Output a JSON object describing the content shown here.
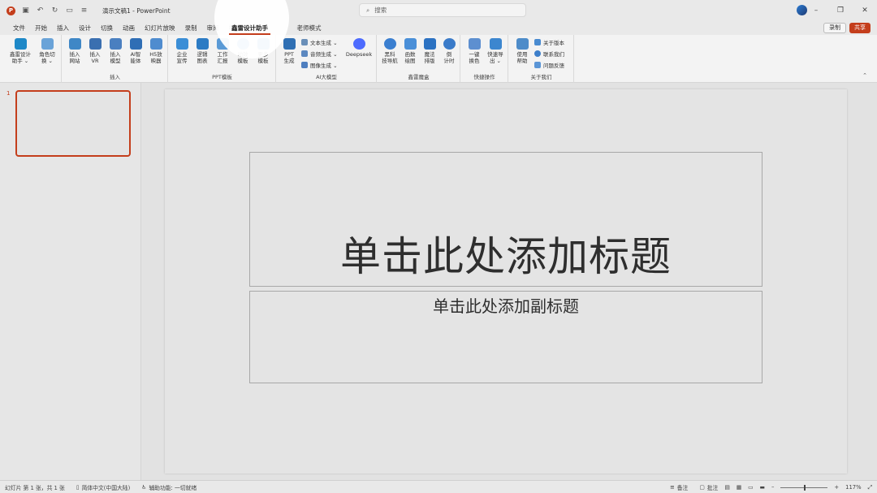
{
  "app": {
    "doc_title": "演示文稿1",
    "app_name": "PowerPoint",
    "title_sep": " - "
  },
  "search": {
    "placeholder": "搜索"
  },
  "title_icons": [
    "powerpoint-logo",
    "save-icon",
    "undo-icon",
    "redo-icon",
    "customize-icon"
  ],
  "tabs": [
    "文件",
    "开始",
    "插入",
    "设计",
    "切换",
    "动画",
    "幻灯片放映",
    "录制",
    "审阅",
    "视图",
    "鑫雷设计助手",
    "老师模式"
  ],
  "active_tab": "鑫雷设计助手",
  "right_buttons": {
    "record": "录制",
    "share": "共享"
  },
  "ribbon": {
    "groups": {
      "g1": {
        "label": "",
        "buttons": [
          {
            "label": "鑫雷设计\n助手 ⌄",
            "color": "#1e88c7"
          },
          {
            "label": "角色切\n换 ⌄",
            "color": "#6aa3d8"
          }
        ]
      },
      "insert": {
        "label": "插入",
        "buttons": [
          {
            "label": "插入\n网站",
            "color": "#3f87c6"
          },
          {
            "label": "插入\nVR",
            "color": "#3a6fb0"
          },
          {
            "label": "插入\n模型",
            "color": "#4a7fc0"
          },
          {
            "label": "AI智\n能体",
            "color": "#2f6eb5"
          },
          {
            "label": "H5放\n映器",
            "color": "#4f8ccf"
          }
        ]
      },
      "ppt": {
        "label": "PPT模板",
        "buttons": [
          {
            "label": "企业\n宣传",
            "color": "#3b8ed6"
          },
          {
            "label": "逻辑\n图表",
            "color": "#2c7bc4"
          },
          {
            "label": "工作\n汇报",
            "color": "#5a9ad6"
          },
          {
            "label": "动效\n模板",
            "color": "#4fa3e3"
          },
          {
            "label": "更多\n模板",
            "color": "#3d8ad4"
          }
        ]
      },
      "ai": {
        "label": "AI大模型",
        "buttons": [
          {
            "label": "PPT\n生成",
            "color": "#2f6fb3"
          }
        ],
        "small": [
          "文本生成 ⌄",
          "音频生成 ⌄",
          "图像生成 ⌄"
        ],
        "deepseek": "Deepseek"
      },
      "magic": {
        "label": "鑫雷魔盒",
        "buttons": [
          {
            "label": "黑科\n技导航",
            "color": "#3b7fd0"
          },
          {
            "label": "函数\n绘图",
            "color": "#4a8fd8"
          },
          {
            "label": "魔法\n排版",
            "color": "#2c72c2"
          },
          {
            "label": "倒\n计时",
            "color": "#3a7bc9"
          }
        ]
      },
      "quick": {
        "label": "快捷操作",
        "buttons": [
          {
            "label": "一键\n换色",
            "color": "#5d8fd0"
          },
          {
            "label": "快速导\n出 ⌄",
            "color": "#3c86cf"
          }
        ]
      },
      "about": {
        "label": "关于我们",
        "buttons": [
          {
            "label": "使用\n帮助",
            "color": "#4e8cc9"
          }
        ],
        "small": [
          "关于版本",
          "联系我们",
          "问题反馈"
        ]
      }
    }
  },
  "thumbnail": {
    "number": "1"
  },
  "slide": {
    "title_placeholder": "单击此处添加标题",
    "subtitle_placeholder": "单击此处添加副标题"
  },
  "status": {
    "slide_info": "幻灯片 第 1 张，共 1 张",
    "language": "简体中文(中国大陆)",
    "accessibility": "辅助功能: 一切就绪",
    "notes": "备注",
    "comments": "批注",
    "zoom": "117%",
    "zoom_level_fraction": 0.5
  },
  "colors": {
    "accent": "#c43e1c",
    "ribbon_bg": "#f3f3f3"
  }
}
